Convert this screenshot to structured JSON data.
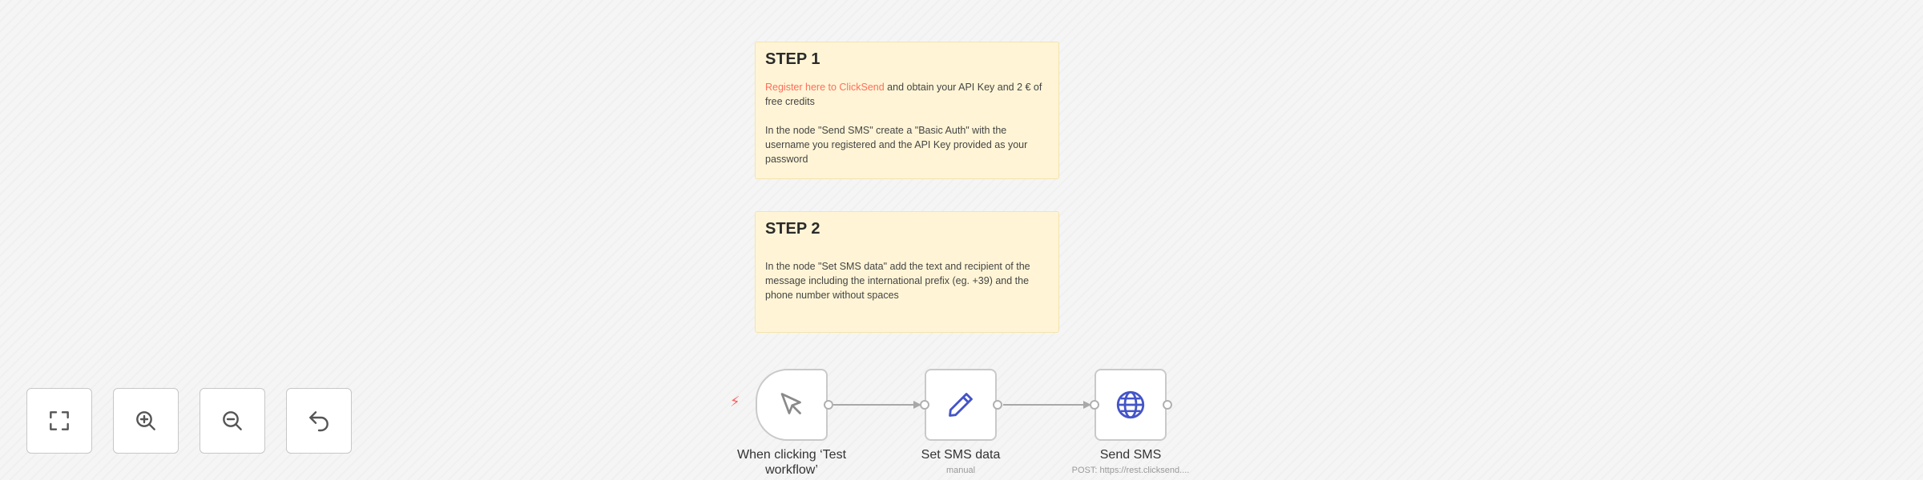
{
  "canvas": {
    "sticky_notes": [
      {
        "title": "STEP 1",
        "link_text": "Register here to ClickSend",
        "text_after_link": " and obtain your API Key and 2 € of free credits",
        "paragraph2": "In the node \"Send SMS\" create a \"Basic Auth\" with the username you registered and the API Key provided as your password"
      },
      {
        "title": "STEP 2",
        "paragraph1": "In the node \"Set SMS data\" add the text and recipient of the message including the international prefix (eg. +39) and the phone number without spaces"
      }
    ],
    "nodes": [
      {
        "label": "When clicking ‘Test workflow’",
        "subtitle": "",
        "icon": "cursor-icon"
      },
      {
        "label": "Set SMS data",
        "subtitle": "manual",
        "icon": "pencil-icon"
      },
      {
        "label": "Send SMS",
        "subtitle": "POST: https://rest.clicksend....",
        "icon": "globe-icon"
      }
    ],
    "colors": {
      "background": "#f5f5f5",
      "sticky": "#fff5d6",
      "link": "#ff6d5a",
      "trigger_bolt": "#ff5e5e",
      "node_icon": "#4454c8"
    }
  },
  "controls": {
    "buttons": [
      {
        "name": "fit-view",
        "icon": "fullscreen-icon"
      },
      {
        "name": "zoom-in",
        "icon": "zoom-in-icon"
      },
      {
        "name": "zoom-out",
        "icon": "zoom-out-icon"
      },
      {
        "name": "reset-zoom",
        "icon": "undo-icon"
      }
    ]
  }
}
